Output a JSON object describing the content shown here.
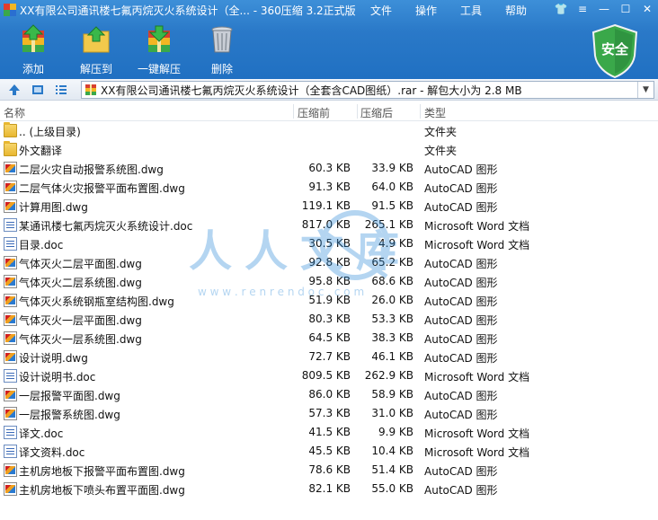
{
  "window": {
    "title": "XX有限公司通讯楼七氟丙烷灭火系统设计（全... - 360压缩 3.2正式版",
    "menu": [
      "文件",
      "操作",
      "工具",
      "帮助"
    ]
  },
  "toolbar": {
    "buttons": [
      {
        "label": "添加",
        "icon": "add-archive-icon"
      },
      {
        "label": "解压到",
        "icon": "extract-to-icon"
      },
      {
        "label": "一键解压",
        "icon": "one-click-extract-icon"
      },
      {
        "label": "删除",
        "icon": "trash-icon"
      }
    ],
    "security_label": "安全"
  },
  "address": {
    "path": "XX有限公司通讯楼七氟丙烷灭火系统设计（全套含CAD图纸）.rar - 解包大小为 2.8 MB"
  },
  "columns": {
    "name": "名称",
    "packed": "压缩前",
    "compressed": "压缩后",
    "type": "类型"
  },
  "files": [
    {
      "icon": "folder",
      "name": ".. (上级目录)",
      "before": "",
      "after": "",
      "type": "文件夹"
    },
    {
      "icon": "folder",
      "name": "外文翻译",
      "before": "",
      "after": "",
      "type": "文件夹"
    },
    {
      "icon": "dwg",
      "name": "二层火灾自动报警系统图.dwg",
      "before": "60.3 KB",
      "after": "33.9 KB",
      "type": "AutoCAD 图形"
    },
    {
      "icon": "dwg",
      "name": "二层气体火灾报警平面布置图.dwg",
      "before": "91.3 KB",
      "after": "64.0 KB",
      "type": "AutoCAD 图形"
    },
    {
      "icon": "dwg",
      "name": "计算用图.dwg",
      "before": "119.1 KB",
      "after": "91.5 KB",
      "type": "AutoCAD 图形"
    },
    {
      "icon": "doc",
      "name": "某通讯楼七氟丙烷灭火系统设计.doc",
      "before": "817.0 KB",
      "after": "265.1 KB",
      "type": "Microsoft Word 文档"
    },
    {
      "icon": "doc",
      "name": "目录.doc",
      "before": "30.5 KB",
      "after": "4.9 KB",
      "type": "Microsoft Word 文档"
    },
    {
      "icon": "dwg",
      "name": "气体灭火二层平面图.dwg",
      "before": "92.8 KB",
      "after": "65.2 KB",
      "type": "AutoCAD 图形"
    },
    {
      "icon": "dwg",
      "name": "气体灭火二层系统图.dwg",
      "before": "95.8 KB",
      "after": "68.6 KB",
      "type": "AutoCAD 图形"
    },
    {
      "icon": "dwg",
      "name": "气体灭火系统钢瓶室结构图.dwg",
      "before": "51.9 KB",
      "after": "26.0 KB",
      "type": "AutoCAD 图形"
    },
    {
      "icon": "dwg",
      "name": "气体灭火一层平面图.dwg",
      "before": "80.3 KB",
      "after": "53.3 KB",
      "type": "AutoCAD 图形"
    },
    {
      "icon": "dwg",
      "name": "气体灭火一层系统图.dwg",
      "before": "64.5 KB",
      "after": "38.3 KB",
      "type": "AutoCAD 图形"
    },
    {
      "icon": "dwg",
      "name": "设计说明.dwg",
      "before": "72.7 KB",
      "after": "46.1 KB",
      "type": "AutoCAD 图形"
    },
    {
      "icon": "doc",
      "name": "设计说明书.doc",
      "before": "809.5 KB",
      "after": "262.9 KB",
      "type": "Microsoft Word 文档"
    },
    {
      "icon": "dwg",
      "name": "一层报警平面图.dwg",
      "before": "86.0 KB",
      "after": "58.9 KB",
      "type": "AutoCAD 图形"
    },
    {
      "icon": "dwg",
      "name": "一层报警系统图.dwg",
      "before": "57.3 KB",
      "after": "31.0 KB",
      "type": "AutoCAD 图形"
    },
    {
      "icon": "doc",
      "name": "译文.doc",
      "before": "41.5 KB",
      "after": "9.9 KB",
      "type": "Microsoft Word 文档"
    },
    {
      "icon": "doc",
      "name": "译文资料.doc",
      "before": "45.5 KB",
      "after": "10.4 KB",
      "type": "Microsoft Word 文档"
    },
    {
      "icon": "dwg",
      "name": "主机房地板下报警平面布置图.dwg",
      "before": "78.6 KB",
      "after": "51.4 KB",
      "type": "AutoCAD 图形"
    },
    {
      "icon": "dwg",
      "name": "主机房地板下喷头布置平面图.dwg",
      "before": "82.1 KB",
      "after": "55.0 KB",
      "type": "AutoCAD 图形"
    }
  ],
  "watermark": {
    "text": "人人文库",
    "url": "w w w . r e n r e n d o c . c o m"
  },
  "colors": {
    "toolbar": "#2a79c8",
    "shield": "#3aa84a",
    "watermark": "#2a8ad8"
  }
}
